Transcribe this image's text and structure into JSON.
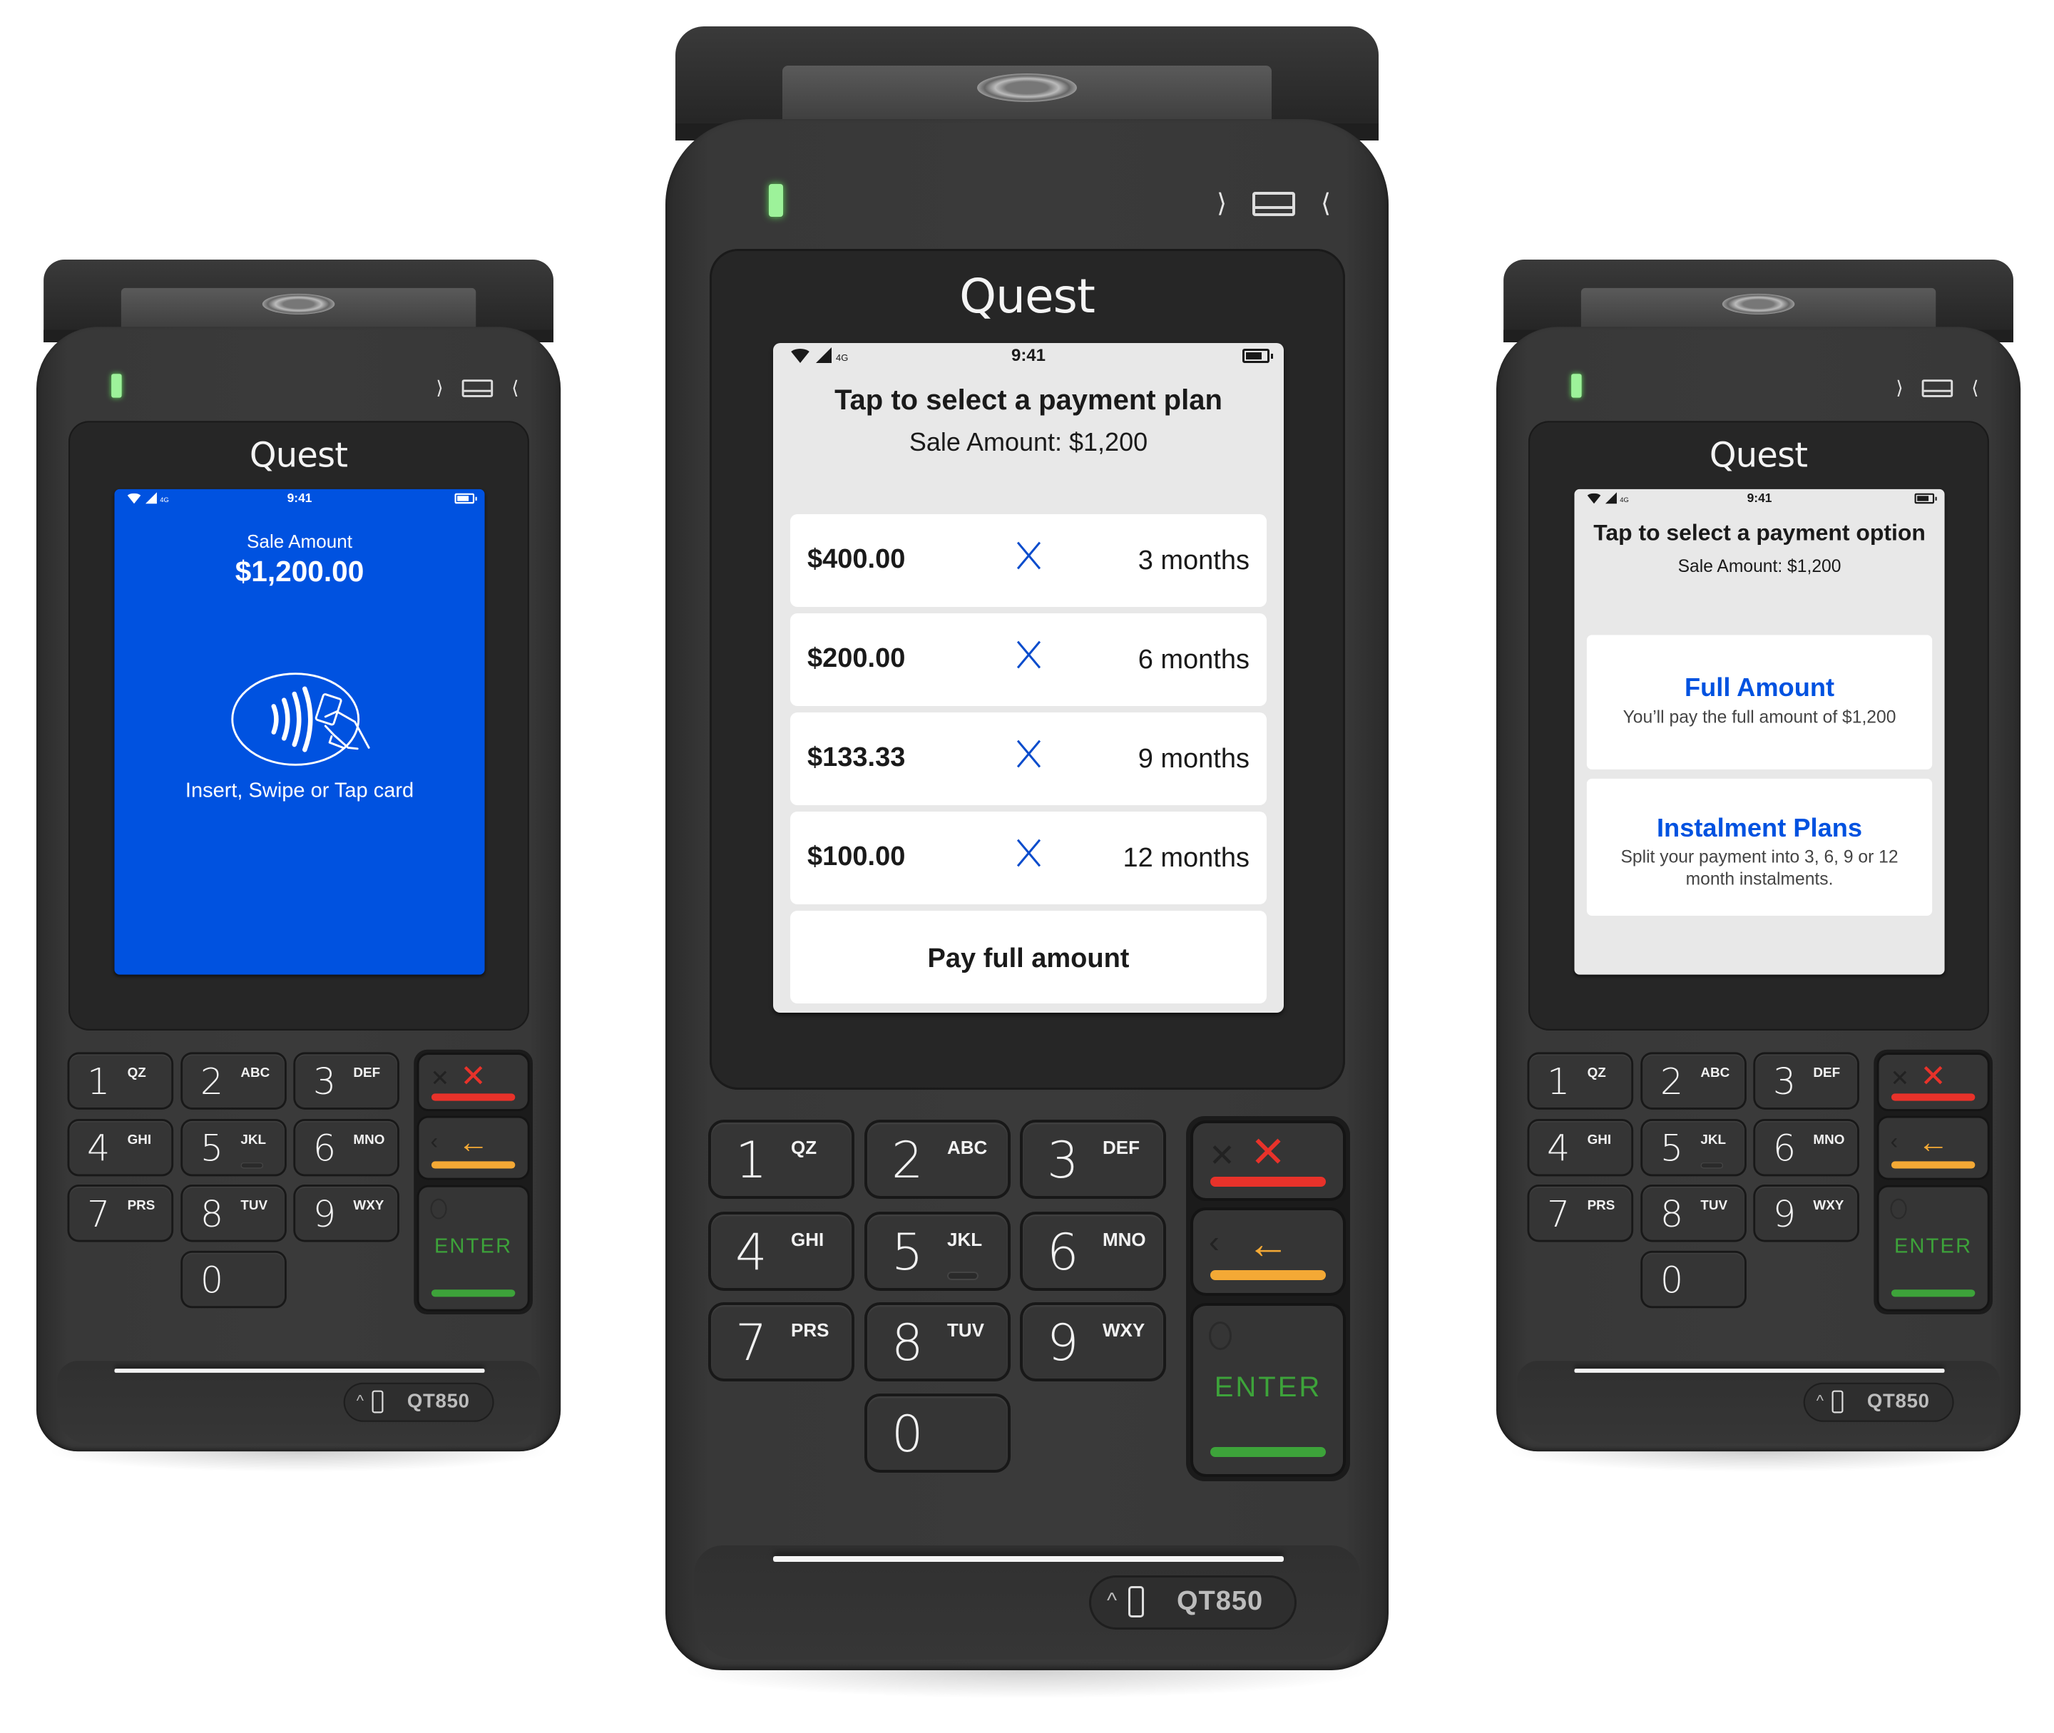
{
  "devices": {
    "left": {
      "brand": "Quest",
      "model": "QT850",
      "status": {
        "time": "9:41",
        "network": "4G"
      },
      "screen": {
        "type": "card-prompt",
        "label": "Sale Amount",
        "amount": "$1,200.00",
        "icon": "contactless-tap-icon",
        "prompt": "Insert, Swipe or Tap card",
        "background": "#0052E0"
      }
    },
    "center": {
      "brand": "Quest",
      "model": "QT850",
      "status": {
        "time": "9:41",
        "network": "4G"
      },
      "screen": {
        "type": "payment-plan",
        "title": "Tap to select a payment plan",
        "subtitle": "Sale Amount: $1,200",
        "plans": [
          {
            "amount": "$400.00",
            "term": "3 months"
          },
          {
            "amount": "$200.00",
            "term": "6 months"
          },
          {
            "amount": "$133.33",
            "term": "9 months"
          },
          {
            "amount": "$100.00",
            "term": "12 months"
          }
        ],
        "full_label": "Pay full amount"
      }
    },
    "right": {
      "brand": "Quest",
      "model": "QT850",
      "status": {
        "time": "9:41",
        "network": "4G"
      },
      "screen": {
        "type": "payment-option",
        "title": "Tap to select a payment option",
        "subtitle": "Sale Amount: $1,200",
        "options": [
          {
            "heading": "Full Amount",
            "desc": "You’ll pay the full amount of $1,200"
          },
          {
            "heading": "Instalment Plans",
            "desc": "Split your payment into 3, 6, 9 or 12 month instalments."
          }
        ],
        "accent": "#0052E0"
      }
    }
  },
  "keypad": {
    "keys": [
      {
        "num": "1",
        "letters": "QZ"
      },
      {
        "num": "2",
        "letters": "ABC"
      },
      {
        "num": "3",
        "letters": "DEF"
      },
      {
        "num": "4",
        "letters": "GHI"
      },
      {
        "num": "5",
        "letters": "JKL"
      },
      {
        "num": "6",
        "letters": "MNO"
      },
      {
        "num": "7",
        "letters": "PRS"
      },
      {
        "num": "8",
        "letters": "TUV"
      },
      {
        "num": "9",
        "letters": "WXY"
      },
      {
        "num": "0",
        "letters": ""
      }
    ],
    "cancel_symbol": "✕",
    "clear_symbol": "←",
    "enter_label": "ENTER",
    "colors": {
      "cancel": "#E8322A",
      "clear": "#F4A935",
      "enter": "#3DA33A"
    }
  },
  "card_reader": {
    "left_chevron": "⟩",
    "right_chevron": "⟨"
  },
  "model_caret": "^"
}
